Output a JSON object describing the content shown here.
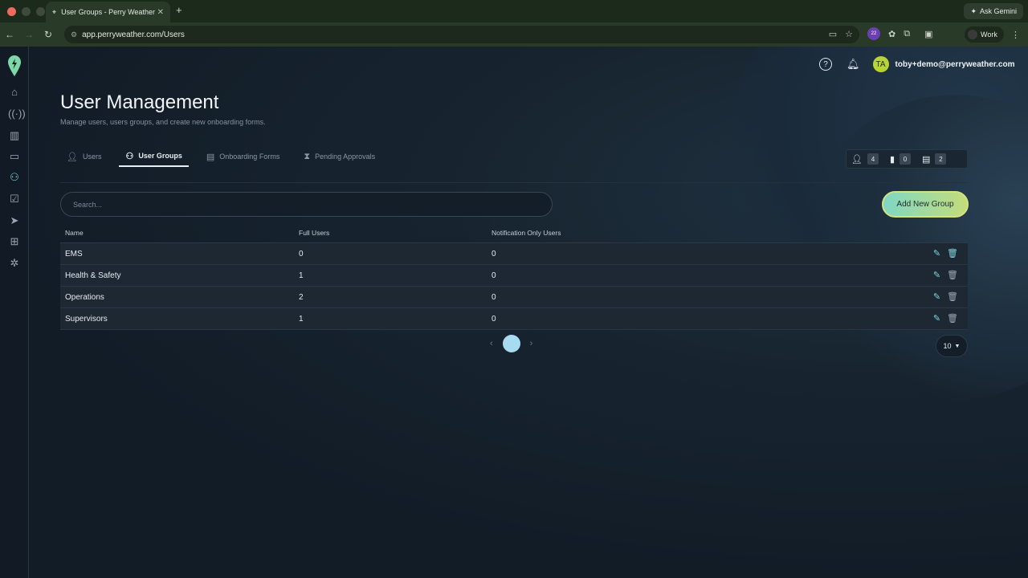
{
  "browser": {
    "tab_title": "User Groups - Perry Weather",
    "tab_close": "✕",
    "new_tab": "+",
    "gemini_label": "Ask Gemini",
    "url": "app.perryweather.com/Users",
    "profile_label": "Work",
    "extension_badge": "22"
  },
  "header": {
    "avatar_initials": "TA",
    "email": "toby+demo@perryweather.com"
  },
  "page": {
    "title": "User Management",
    "subtitle": "Manage users, users groups, and create new onboarding forms."
  },
  "tabs": [
    {
      "label": "Users",
      "icon": "user-icon"
    },
    {
      "label": "User Groups",
      "icon": "users-icon",
      "active": true
    },
    {
      "label": "Onboarding Forms",
      "icon": "form-icon"
    },
    {
      "label": "Pending Approvals",
      "icon": "hourglass-icon"
    }
  ],
  "stats": {
    "users": "4",
    "messages": "0",
    "forms": "2"
  },
  "search": {
    "placeholder": "Search..."
  },
  "add_button": {
    "label": "Add New Group"
  },
  "table": {
    "headers": [
      "Name",
      "Full Users",
      "Notification Only Users"
    ],
    "rows": [
      {
        "name": "EMS",
        "full": "0",
        "notify": "0"
      },
      {
        "name": "Health & Safety",
        "full": "1",
        "notify": "0"
      },
      {
        "name": "Operations",
        "full": "2",
        "notify": "0"
      },
      {
        "name": "Supervisors",
        "full": "1",
        "notify": "0"
      }
    ]
  },
  "pagination": {
    "prev": "‹",
    "current": "1",
    "next": "›",
    "per_page": "10"
  },
  "colors": {
    "accent": "#7fd6e0",
    "button_gradient_start": "#7fd8c4",
    "button_gradient_end": "#c4dc7a",
    "avatar": "#b8d332"
  }
}
